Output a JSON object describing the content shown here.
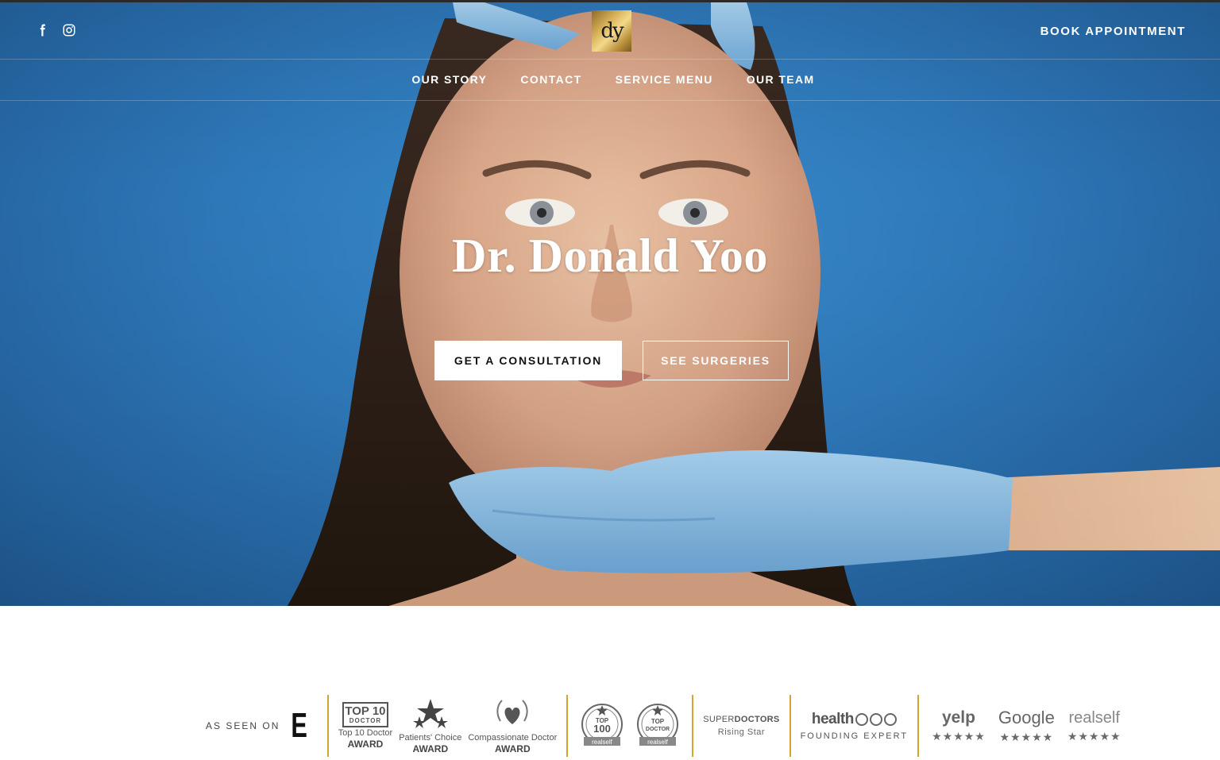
{
  "header": {
    "book_label": "BOOK APPOINTMENT",
    "logo_text": "dy",
    "social": [
      "facebook-icon",
      "instagram-icon"
    ]
  },
  "nav": {
    "items": [
      "OUR STORY",
      "CONTACT",
      "SERVICE MENU",
      "OUR TEAM"
    ]
  },
  "hero": {
    "title": "Dr. Donald Yoo",
    "primary_button": "GET A CONSULTATION",
    "secondary_button": "SEE SURGERIES"
  },
  "awards": {
    "seen_label": "AS SEEN ON",
    "e_logo": "E",
    "top10": {
      "badge_line1": "TOP 10",
      "badge_line2": "DOCTOR",
      "caption": "Top 10 Doctor",
      "caption2": "AWARD"
    },
    "patients_choice": {
      "caption": "Patients' Choice",
      "caption2": "AWARD"
    },
    "compassionate": {
      "caption": "Compassionate Doctor",
      "caption2": "AWARD"
    },
    "realself_top100": {
      "line1": "TOP",
      "line2": "100",
      "ribbon": "realself"
    },
    "realself_topdoctor": {
      "line1": "TOP",
      "line2": "DOCTOR",
      "ribbon": "realself"
    },
    "superdoctors": {
      "super": "SUPER",
      "doctors": "DOCTORS",
      "sub": "Rising Star"
    },
    "healthtap": {
      "name": "health",
      "sub": "FOUNDING EXPERT"
    },
    "reviews": [
      {
        "name": "yelp",
        "stars": "★★★★★"
      },
      {
        "name": "Google",
        "stars": "★★★★★"
      },
      {
        "name": "realself",
        "stars": "★★★★★"
      }
    ]
  },
  "colors": {
    "hero_blue": "#2e78b9",
    "glove_blue": "#8cc3ea",
    "gold_accent": "#d4a52c",
    "white": "#ffffff"
  }
}
